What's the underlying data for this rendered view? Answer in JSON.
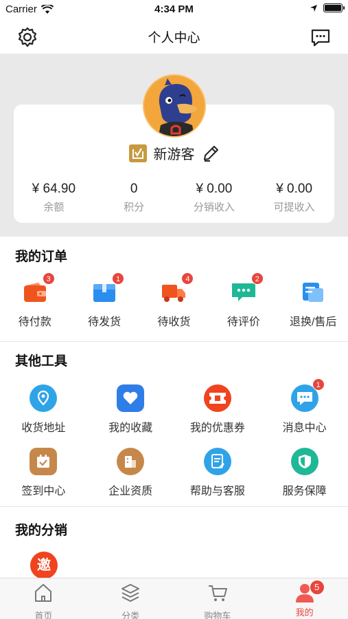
{
  "status_bar": {
    "carrier": "Carrier",
    "time": "4:34 PM"
  },
  "nav": {
    "title": "个人中心",
    "left_icon": "gear-icon",
    "right_icon": "message-icon"
  },
  "profile": {
    "name": "新游客",
    "stats": [
      {
        "value": "¥ 64.90",
        "label": "余额"
      },
      {
        "value": "0",
        "label": "积分"
      },
      {
        "value": "¥ 0.00",
        "label": "分销收入"
      },
      {
        "value": "¥ 0.00",
        "label": "可提收入"
      }
    ]
  },
  "orders": {
    "title": "我的订单",
    "items": [
      {
        "label": "待付款",
        "badge": "3",
        "icon": "wallet-icon",
        "color": "#f0541e"
      },
      {
        "label": "待发货",
        "badge": "1",
        "icon": "box-icon",
        "color": "#2a8ef0"
      },
      {
        "label": "待收货",
        "badge": "4",
        "icon": "truck-icon",
        "color": "#f0541e"
      },
      {
        "label": "待评价",
        "badge": "2",
        "icon": "comment-icon",
        "color": "#1fb896"
      },
      {
        "label": "退换/售后",
        "badge": "",
        "icon": "return-icon",
        "color": "#2a8ef0"
      }
    ]
  },
  "tools": {
    "title": "其他工具",
    "items": [
      {
        "label": "收货地址",
        "badge": "",
        "icon": "location-icon",
        "color": "#2fa3e8"
      },
      {
        "label": "我的收藏",
        "badge": "",
        "icon": "heart-icon",
        "color": "#2f7ee8"
      },
      {
        "label": "我的优惠券",
        "badge": "",
        "icon": "coupon-icon",
        "color": "#f0431e"
      },
      {
        "label": "消息中心",
        "badge": "1",
        "icon": "chat-icon",
        "color": "#2fa3e8"
      },
      {
        "label": "签到中心",
        "badge": "",
        "icon": "calendar-icon",
        "color": "#c6884a"
      },
      {
        "label": "企业资质",
        "badge": "",
        "icon": "building-icon",
        "color": "#c6884a"
      },
      {
        "label": "帮助与客服",
        "badge": "",
        "icon": "help-doc-icon",
        "color": "#2fa3e8"
      },
      {
        "label": "服务保障",
        "badge": "",
        "icon": "shield-icon",
        "color": "#1fb896"
      }
    ]
  },
  "distribution": {
    "title": "我的分销",
    "invite_glyph": "邀"
  },
  "tabs": [
    {
      "label": "首页",
      "icon": "home-icon",
      "badge": ""
    },
    {
      "label": "分类",
      "icon": "layers-icon",
      "badge": ""
    },
    {
      "label": "购物车",
      "icon": "cart-icon",
      "badge": ""
    },
    {
      "label": "我的",
      "icon": "user-icon",
      "badge": "5"
    }
  ],
  "colors": {
    "accent": "#e8453c",
    "card_bg": "#ffffff",
    "header_bg": "#e9e9e9"
  }
}
